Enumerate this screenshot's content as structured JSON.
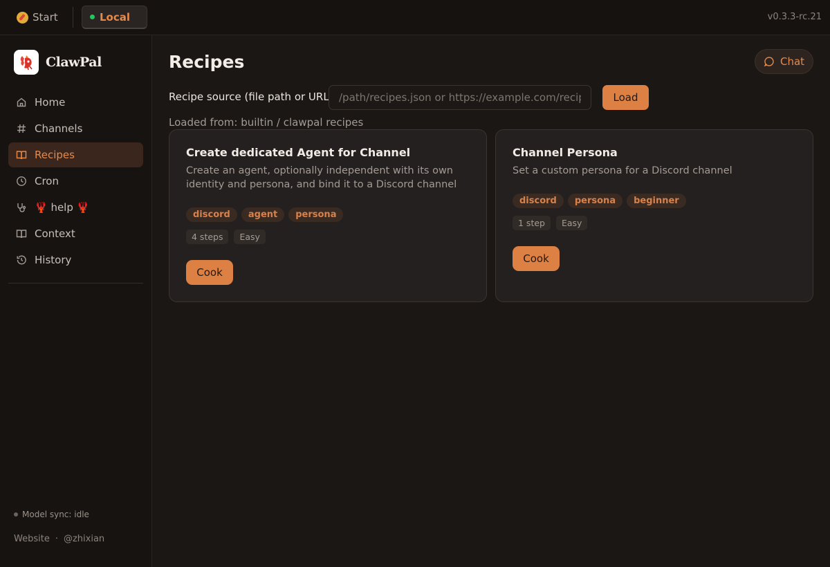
{
  "topbar": {
    "start_label": "Start",
    "local_label": "Local",
    "version": "v0.3.3-rc.21"
  },
  "sidebar": {
    "brand": "ClawPal",
    "items": [
      {
        "label": "Home",
        "icon": "home-icon"
      },
      {
        "label": "Channels",
        "icon": "hash-icon"
      },
      {
        "label": "Recipes",
        "icon": "book-icon",
        "active": true
      },
      {
        "label": "Cron",
        "icon": "clock-icon"
      },
      {
        "label": "🦞 help 🦞",
        "icon": "stethoscope-icon"
      },
      {
        "label": "Context",
        "icon": "book-icon"
      },
      {
        "label": "History",
        "icon": "history-icon"
      }
    ],
    "model_sync": "Model sync: idle",
    "links": {
      "website": "Website",
      "separator": "·",
      "author": "@zhixian"
    }
  },
  "main": {
    "title": "Recipes",
    "chat_label": "Chat",
    "source_label": "Recipe source (file path or URL)",
    "source_placeholder": "/path/recipes.json or https://example.com/recipes.json",
    "load_label": "Load",
    "loaded_from": "Loaded from: builtin / clawpal recipes",
    "cards": [
      {
        "title": "Create dedicated Agent for Channel",
        "description": "Create an agent, optionally independent with its own identity and persona, and bind it to a Discord channel",
        "tags": [
          "discord",
          "agent",
          "persona"
        ],
        "steps": "4 steps",
        "difficulty": "Easy",
        "cook_label": "Cook"
      },
      {
        "title": "Channel Persona",
        "description": "Set a custom persona for a Discord channel",
        "tags": [
          "discord",
          "persona",
          "beginner"
        ],
        "steps": "1 step",
        "difficulty": "Easy",
        "cook_label": "Cook"
      }
    ]
  },
  "colors": {
    "accent": "#dd8044",
    "background": "#1b1715",
    "active_dot": "#22c55e"
  }
}
